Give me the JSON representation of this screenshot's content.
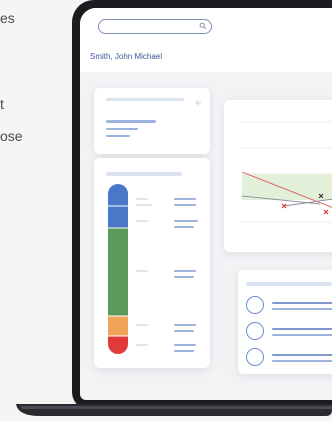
{
  "left_text": {
    "line1": "es",
    "line2": "t",
    "line3": "ose"
  },
  "app": {
    "search": {
      "placeholder": "",
      "icon": "search-icon"
    },
    "patient_name": "Smith, John Michael"
  },
  "colors": {
    "header_bg": "#ffffff",
    "accent_blue": "#3a5a9a",
    "bar_blue": "#4a78c8",
    "bar_green": "#5a9a5a",
    "bar_orange": "#f0a45a",
    "bar_red": "#e03a3a"
  },
  "gauge": {
    "segments": [
      {
        "name": "blue",
        "value": 0.13
      },
      {
        "name": "green",
        "value": 0.62
      },
      {
        "name": "orange",
        "value": 0.12
      },
      {
        "name": "red",
        "value": 0.13
      }
    ]
  }
}
